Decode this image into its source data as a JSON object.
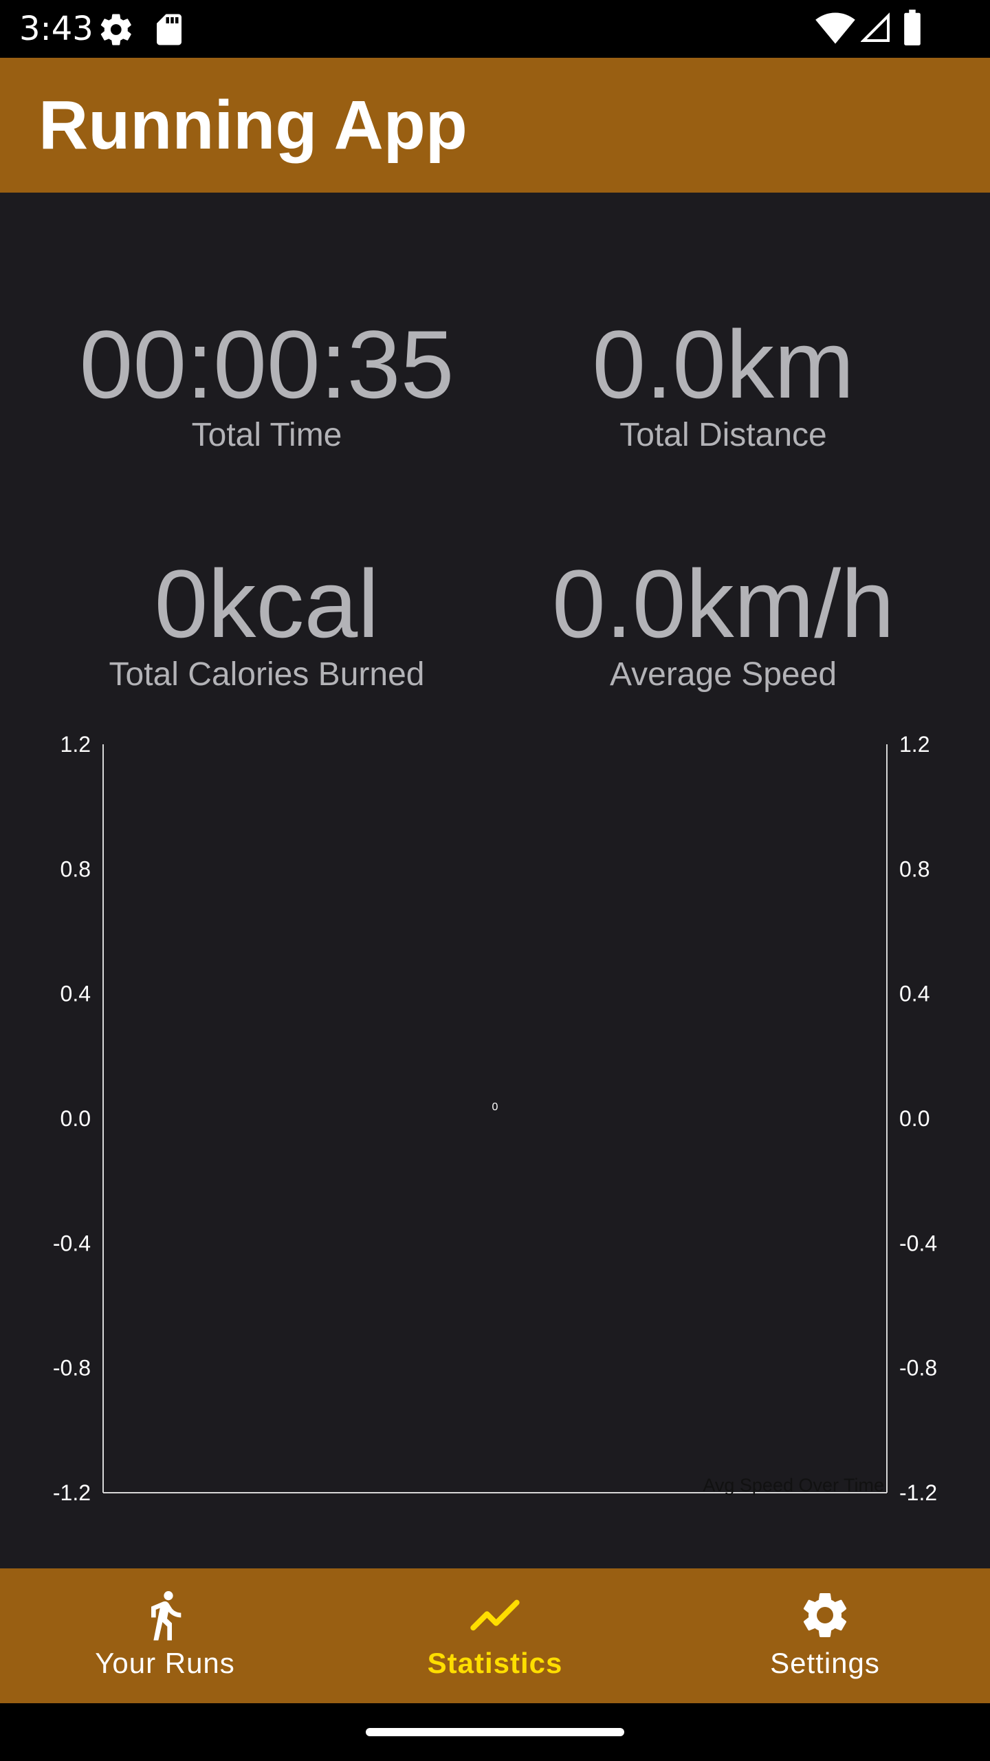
{
  "status_bar": {
    "time": "3:43",
    "icons_left": [
      "settings-gear-icon",
      "sd-card-icon"
    ],
    "icons_right": [
      "wifi-icon",
      "cell-signal-icon",
      "battery-icon"
    ]
  },
  "app_bar": {
    "title": "Running App",
    "color": "#995f12"
  },
  "stats": {
    "total_time": {
      "value": "00:00:35",
      "label": "Total Time"
    },
    "total_distance": {
      "value": "0.0km",
      "label": "Total Distance"
    },
    "total_calories": {
      "value": "0kcal",
      "label": "Total Calories Burned"
    },
    "average_speed": {
      "value": "0.0km/h",
      "label": "Average Speed"
    }
  },
  "chart_data": {
    "type": "bar",
    "title": "",
    "description_label": "Avg Speed Over Time",
    "xlabel": "",
    "ylabel": "",
    "ylim": [
      -1.2,
      1.2
    ],
    "y_ticks": [
      "1.2",
      "0.8",
      "0.4",
      "0.0",
      "-0.4",
      "-0.8",
      "-1.2"
    ],
    "categories": [
      "0"
    ],
    "values": [
      0
    ],
    "value_labels": [
      "0"
    ],
    "dual_y_axis": true,
    "grid": false
  },
  "bottom_nav": {
    "items": [
      {
        "label": "Your Runs",
        "icon": "running-person-icon",
        "active": false
      },
      {
        "label": "Statistics",
        "icon": "trending-line-icon",
        "active": true
      },
      {
        "label": "Settings",
        "icon": "gear-icon",
        "active": false
      }
    ],
    "active_color": "#ffde00"
  }
}
